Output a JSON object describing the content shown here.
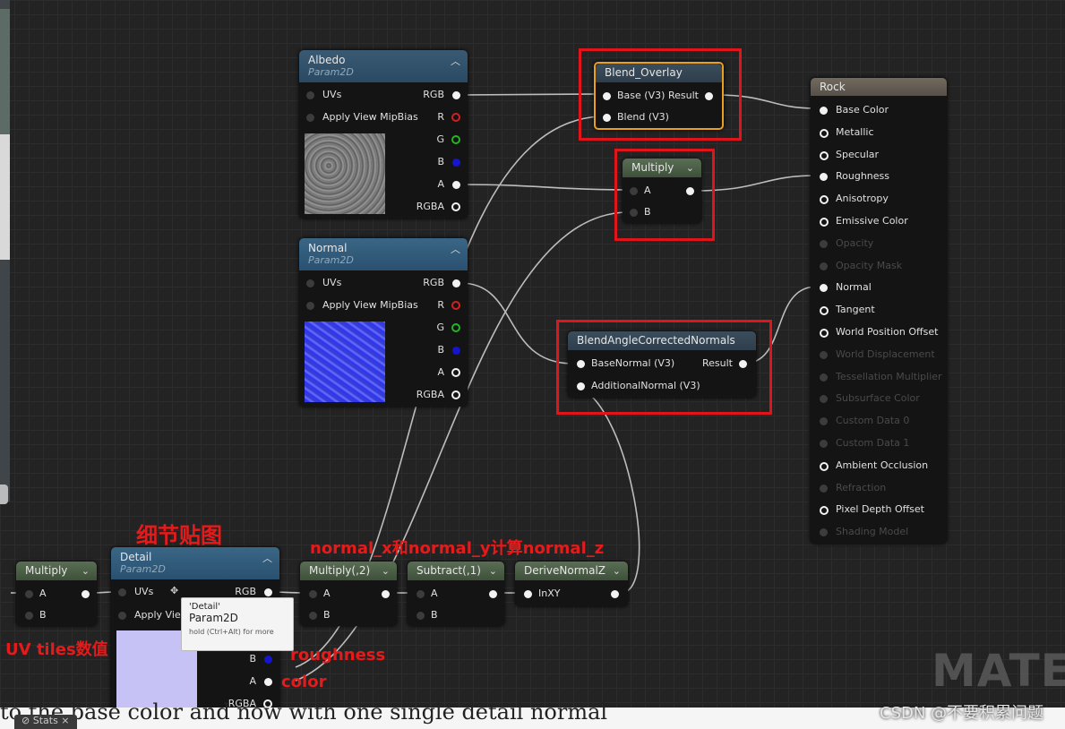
{
  "nodes": {
    "albedo": {
      "title": "Albedo",
      "subtitle": "Param2D",
      "pins_in": [
        "UVs",
        "Apply View MipBias"
      ],
      "pins_out": [
        "RGB",
        "R",
        "G",
        "B",
        "A",
        "RGBA"
      ]
    },
    "normal": {
      "title": "Normal",
      "subtitle": "Param2D",
      "pins_in": [
        "UVs",
        "Apply View MipBias"
      ],
      "pins_out": [
        "RGB",
        "R",
        "G",
        "B",
        "A",
        "RGBA"
      ]
    },
    "detail": {
      "title": "Detail",
      "subtitle": "Param2D",
      "pins_in": [
        "UVs",
        "Apply View MipBias"
      ],
      "pins_out": [
        "RGB",
        "B",
        "A",
        "RGBA"
      ]
    },
    "blend_overlay": {
      "title": "Blend_Overlay",
      "pins_in": [
        "Base (V3)",
        "Blend (V3)"
      ],
      "pin_out": "Result"
    },
    "multiply_main": {
      "title": "Multiply",
      "pins_in": [
        "A",
        "B"
      ]
    },
    "blend_normals": {
      "title": "BlendAngleCorrectedNormals",
      "pins_in": [
        "BaseNormal (V3)",
        "AdditionalNormal (V3)"
      ],
      "pin_out": "Result"
    },
    "multiply_left": {
      "title": "Multiply",
      "pins_in": [
        "A",
        "B"
      ]
    },
    "multiply_2": {
      "title": "Multiply(,2)",
      "pins_in": [
        "A",
        "B"
      ]
    },
    "subtract_1": {
      "title": "Subtract(,1)",
      "pins_in": [
        "A",
        "B"
      ]
    },
    "derive_normal_z": {
      "title": "DeriveNormalZ",
      "pins_in": [
        "InXY"
      ]
    },
    "rock": {
      "title": "Rock",
      "pins": [
        "Base Color",
        "Metallic",
        "Specular",
        "Roughness",
        "Anisotropy",
        "Emissive Color",
        "Opacity",
        "Opacity Mask",
        "Normal",
        "Tangent",
        "World Position Offset",
        "World Displacement",
        "Tessellation Multiplier",
        "Subsurface Color",
        "Custom Data 0",
        "Custom Data 1",
        "Ambient Occlusion",
        "Refraction",
        "Pixel Depth Offset",
        "Shading Model"
      ],
      "disabled": [
        false,
        false,
        false,
        false,
        false,
        false,
        true,
        true,
        false,
        false,
        false,
        true,
        true,
        true,
        true,
        true,
        false,
        true,
        false,
        true
      ]
    }
  },
  "tooltip": {
    "line1": "'Detail'",
    "line2": "Param2D",
    "line3": "hold (Ctrl+Alt) for more"
  },
  "annotations": {
    "detail_map": "细节贴图",
    "normal_z": "normal_x和normal_y计算normal_z",
    "uv_tiles": "UV tiles数值",
    "roughness": "roughness",
    "color": "color"
  },
  "caption": "to the base color and now with one single detail normal",
  "watermark": "MATER",
  "csdn": "CSDN @不要积累问题",
  "stats_tab": "Stats",
  "colors": {
    "annotation": "#e51b1b",
    "graph_bg": "#232323",
    "selected": "#e8a020"
  }
}
